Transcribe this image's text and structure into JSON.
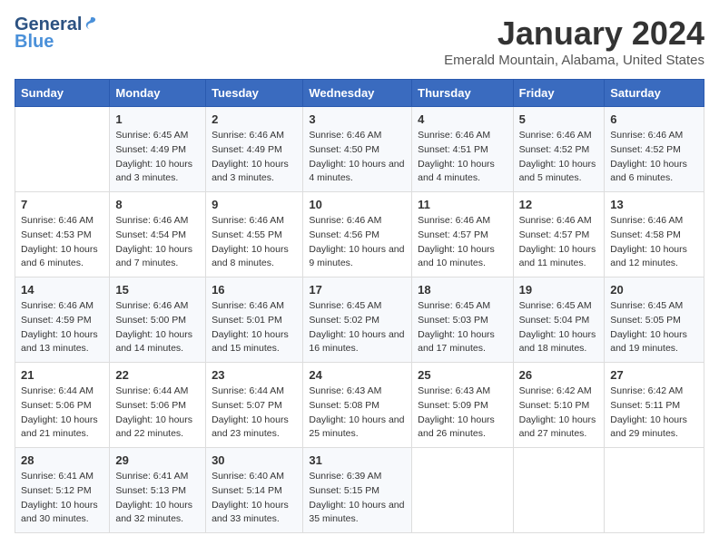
{
  "header": {
    "logo_general": "General",
    "logo_blue": "Blue",
    "title": "January 2024",
    "subtitle": "Emerald Mountain, Alabama, United States"
  },
  "weekdays": [
    "Sunday",
    "Monday",
    "Tuesday",
    "Wednesday",
    "Thursday",
    "Friday",
    "Saturday"
  ],
  "weeks": [
    [
      null,
      {
        "day": 1,
        "sunrise": "6:45 AM",
        "sunset": "4:49 PM",
        "daylight": "10 hours and 3 minutes."
      },
      {
        "day": 2,
        "sunrise": "6:46 AM",
        "sunset": "4:49 PM",
        "daylight": "10 hours and 3 minutes."
      },
      {
        "day": 3,
        "sunrise": "6:46 AM",
        "sunset": "4:50 PM",
        "daylight": "10 hours and 4 minutes."
      },
      {
        "day": 4,
        "sunrise": "6:46 AM",
        "sunset": "4:51 PM",
        "daylight": "10 hours and 4 minutes."
      },
      {
        "day": 5,
        "sunrise": "6:46 AM",
        "sunset": "4:52 PM",
        "daylight": "10 hours and 5 minutes."
      },
      {
        "day": 6,
        "sunrise": "6:46 AM",
        "sunset": "4:52 PM",
        "daylight": "10 hours and 6 minutes."
      }
    ],
    [
      {
        "day": 7,
        "sunrise": "6:46 AM",
        "sunset": "4:53 PM",
        "daylight": "10 hours and 6 minutes."
      },
      {
        "day": 8,
        "sunrise": "6:46 AM",
        "sunset": "4:54 PM",
        "daylight": "10 hours and 7 minutes."
      },
      {
        "day": 9,
        "sunrise": "6:46 AM",
        "sunset": "4:55 PM",
        "daylight": "10 hours and 8 minutes."
      },
      {
        "day": 10,
        "sunrise": "6:46 AM",
        "sunset": "4:56 PM",
        "daylight": "10 hours and 9 minutes."
      },
      {
        "day": 11,
        "sunrise": "6:46 AM",
        "sunset": "4:57 PM",
        "daylight": "10 hours and 10 minutes."
      },
      {
        "day": 12,
        "sunrise": "6:46 AM",
        "sunset": "4:57 PM",
        "daylight": "10 hours and 11 minutes."
      },
      {
        "day": 13,
        "sunrise": "6:46 AM",
        "sunset": "4:58 PM",
        "daylight": "10 hours and 12 minutes."
      }
    ],
    [
      {
        "day": 14,
        "sunrise": "6:46 AM",
        "sunset": "4:59 PM",
        "daylight": "10 hours and 13 minutes."
      },
      {
        "day": 15,
        "sunrise": "6:46 AM",
        "sunset": "5:00 PM",
        "daylight": "10 hours and 14 minutes."
      },
      {
        "day": 16,
        "sunrise": "6:46 AM",
        "sunset": "5:01 PM",
        "daylight": "10 hours and 15 minutes."
      },
      {
        "day": 17,
        "sunrise": "6:45 AM",
        "sunset": "5:02 PM",
        "daylight": "10 hours and 16 minutes."
      },
      {
        "day": 18,
        "sunrise": "6:45 AM",
        "sunset": "5:03 PM",
        "daylight": "10 hours and 17 minutes."
      },
      {
        "day": 19,
        "sunrise": "6:45 AM",
        "sunset": "5:04 PM",
        "daylight": "10 hours and 18 minutes."
      },
      {
        "day": 20,
        "sunrise": "6:45 AM",
        "sunset": "5:05 PM",
        "daylight": "10 hours and 19 minutes."
      }
    ],
    [
      {
        "day": 21,
        "sunrise": "6:44 AM",
        "sunset": "5:06 PM",
        "daylight": "10 hours and 21 minutes."
      },
      {
        "day": 22,
        "sunrise": "6:44 AM",
        "sunset": "5:06 PM",
        "daylight": "10 hours and 22 minutes."
      },
      {
        "day": 23,
        "sunrise": "6:44 AM",
        "sunset": "5:07 PM",
        "daylight": "10 hours and 23 minutes."
      },
      {
        "day": 24,
        "sunrise": "6:43 AM",
        "sunset": "5:08 PM",
        "daylight": "10 hours and 25 minutes."
      },
      {
        "day": 25,
        "sunrise": "6:43 AM",
        "sunset": "5:09 PM",
        "daylight": "10 hours and 26 minutes."
      },
      {
        "day": 26,
        "sunrise": "6:42 AM",
        "sunset": "5:10 PM",
        "daylight": "10 hours and 27 minutes."
      },
      {
        "day": 27,
        "sunrise": "6:42 AM",
        "sunset": "5:11 PM",
        "daylight": "10 hours and 29 minutes."
      }
    ],
    [
      {
        "day": 28,
        "sunrise": "6:41 AM",
        "sunset": "5:12 PM",
        "daylight": "10 hours and 30 minutes."
      },
      {
        "day": 29,
        "sunrise": "6:41 AM",
        "sunset": "5:13 PM",
        "daylight": "10 hours and 32 minutes."
      },
      {
        "day": 30,
        "sunrise": "6:40 AM",
        "sunset": "5:14 PM",
        "daylight": "10 hours and 33 minutes."
      },
      {
        "day": 31,
        "sunrise": "6:39 AM",
        "sunset": "5:15 PM",
        "daylight": "10 hours and 35 minutes."
      },
      null,
      null,
      null
    ]
  ]
}
